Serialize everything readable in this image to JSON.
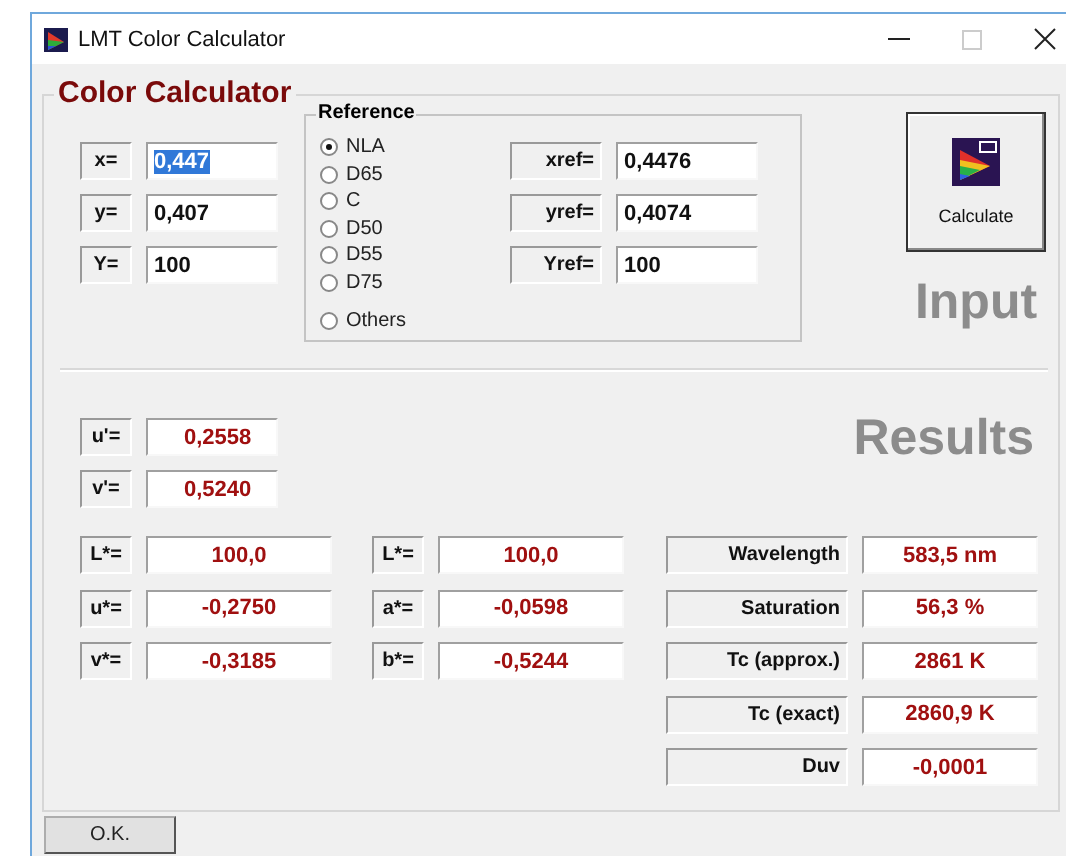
{
  "window": {
    "title": "LMT Color Calculator"
  },
  "group_title": "Color Calculator",
  "inputs": [
    {
      "label": "x=",
      "value": "0,447",
      "selected": true
    },
    {
      "label": "y=",
      "value": "0,407",
      "selected": false
    },
    {
      "label": "Y=",
      "value": "100",
      "selected": false
    }
  ],
  "reference": {
    "title": "Reference",
    "options": [
      {
        "label": "NLA",
        "selected": true
      },
      {
        "label": "D65",
        "selected": false
      },
      {
        "label": "C",
        "selected": false
      },
      {
        "label": "D50",
        "selected": false
      },
      {
        "label": "D55",
        "selected": false
      },
      {
        "label": "D75",
        "selected": false
      },
      {
        "label": "Others",
        "selected": false
      }
    ],
    "fields": [
      {
        "label": "xref=",
        "value": "0,4476"
      },
      {
        "label": "yref=",
        "value": "0,4074"
      },
      {
        "label": "Yref=",
        "value": "100"
      }
    ]
  },
  "calculate_button": "Calculate",
  "input_heading": "Input",
  "results_heading": "Results",
  "uv": [
    {
      "label": "u'=",
      "value": "0,2558"
    },
    {
      "label": "v'=",
      "value": "0,5240"
    }
  ],
  "luv": [
    {
      "label": "L*=",
      "value": "100,0"
    },
    {
      "label": "u*=",
      "value": "-0,2750"
    },
    {
      "label": "v*=",
      "value": "-0,3185"
    }
  ],
  "lab": [
    {
      "label": "L*=",
      "value": "100,0"
    },
    {
      "label": "a*=",
      "value": "-0,0598"
    },
    {
      "label": "b*=",
      "value": "-0,5244"
    }
  ],
  "properties": [
    {
      "label": "Wavelength",
      "value": "583,5 nm"
    },
    {
      "label": "Saturation",
      "value": "56,3 %"
    },
    {
      "label": "Tc (approx.)",
      "value": "2861 K"
    },
    {
      "label": "Tc (exact)",
      "value": "2860,9 K"
    },
    {
      "label": "Duv",
      "value": "-0,0001"
    }
  ],
  "ok_button": "O.K."
}
